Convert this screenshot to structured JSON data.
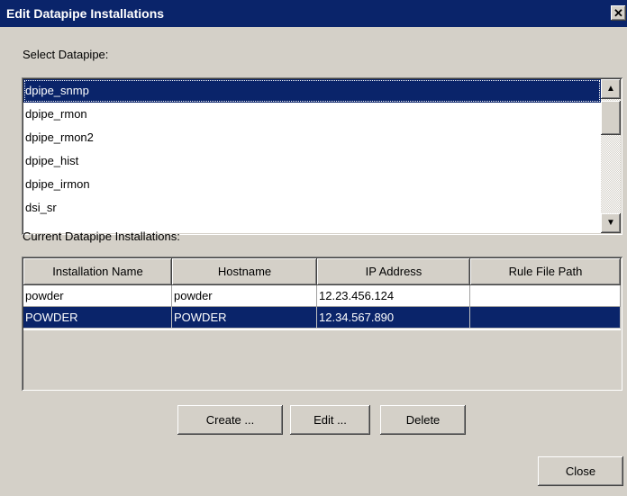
{
  "window": {
    "title": "Edit Datapipe Installations",
    "close_glyph": "✕"
  },
  "select_label": "Select Datapipe:",
  "datapipes": [
    {
      "label": "dpipe_snmp",
      "selected": true
    },
    {
      "label": "dpipe_rmon",
      "selected": false
    },
    {
      "label": "dpipe_rmon2",
      "selected": false
    },
    {
      "label": "dpipe_hist",
      "selected": false
    },
    {
      "label": "dpipe_irmon",
      "selected": false
    },
    {
      "label": "dsi_sr",
      "selected": false
    }
  ],
  "scroll": {
    "up_glyph": "▲",
    "down_glyph": "▼"
  },
  "installations_label": "Current Datapipe Installations:",
  "table": {
    "columns": [
      "Installation Name",
      "Hostname",
      "IP Address",
      "Rule File Path"
    ],
    "rows": [
      {
        "cells": [
          "powder",
          "powder",
          "12.23.456.124",
          ""
        ],
        "selected": false
      },
      {
        "cells": [
          "POWDER",
          "POWDER",
          "12.34.567.890",
          ""
        ],
        "selected": true
      }
    ]
  },
  "buttons": {
    "create": "Create ...",
    "edit": "Edit ...",
    "delete": "Delete",
    "close": "Close"
  },
  "colors": {
    "selection": "#0a246a",
    "dialog_bg": "#d4d0c8"
  }
}
